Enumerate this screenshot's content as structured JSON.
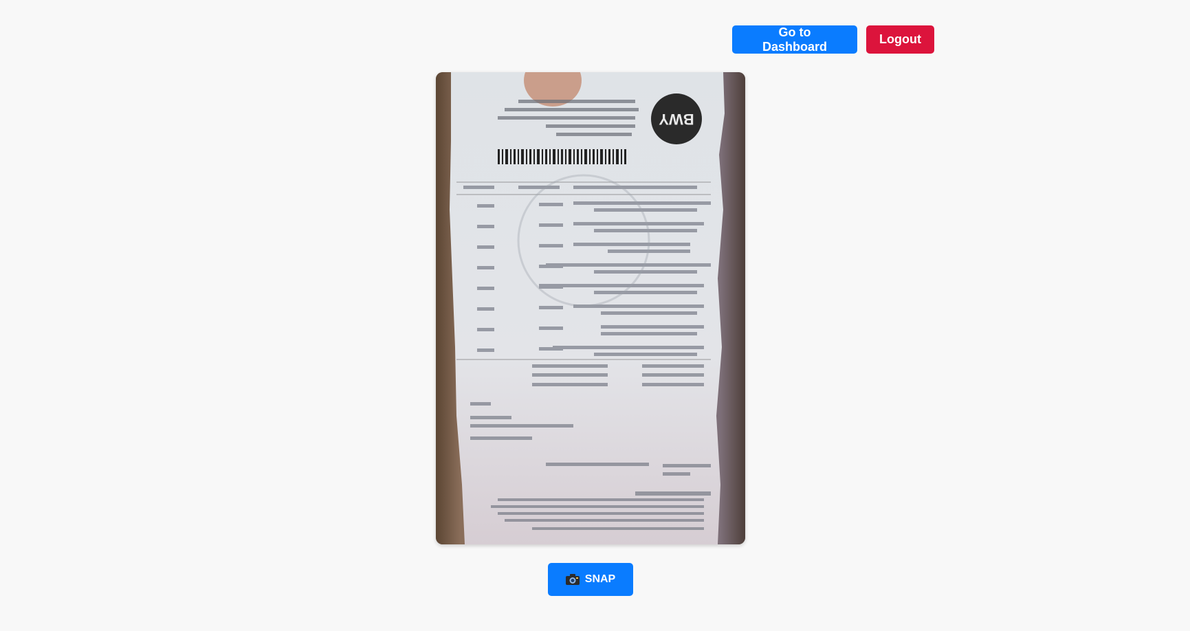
{
  "header": {
    "dashboard_label": "Go to Dashboard",
    "logout_label": "Logout"
  },
  "camera": {
    "feed_description_icon": "receipt-camera-feed"
  },
  "snap": {
    "label": "SNAP",
    "icon": "camera-icon"
  },
  "colors": {
    "primary": "#0a7cff",
    "danger": "#dc143c",
    "background": "#f8f8f8"
  }
}
